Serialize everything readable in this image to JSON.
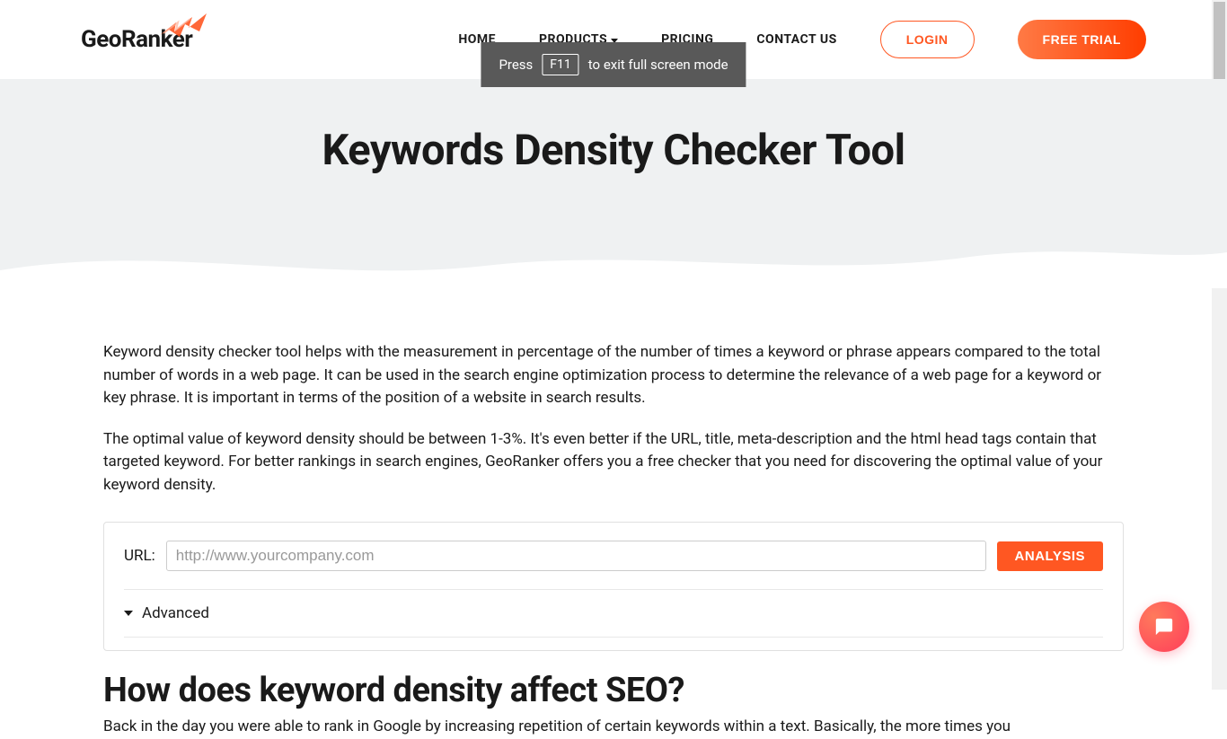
{
  "brand": {
    "name": "GeoRanker"
  },
  "nav": {
    "home": "HOME",
    "products": "PRODUCTS",
    "pricing": "PRICING",
    "contact": "CONTACT US",
    "login": "LOGIN",
    "trial": "FREE TRIAL"
  },
  "hero": {
    "title": "Keywords Density Checker Tool"
  },
  "intro": {
    "p1": "Keyword density checker tool helps with the measurement in percentage of the number of times a keyword or phrase appears compared to the total number of words in a web page. It can be used in the search engine optimization process to determine the relevance of a web page for a keyword or key phrase. It is important in terms of the position of a website in search results.",
    "p2": "The optimal value of keyword density should be between 1-3%. It's even better if the URL, title, meta-description and the html head tags contain that targeted keyword. For better rankings in search engines, GeoRanker offers you a free checker that you need for discovering the optimal value of your keyword density."
  },
  "form": {
    "urlLabel": "URL:",
    "urlPlaceholder": "http://www.yourcompany.com",
    "analysis": "ANALYSIS",
    "advanced": "Advanced"
  },
  "section": {
    "heading": "How does keyword density affect SEO?",
    "body": "Back in the day you were able to rank in Google by increasing repetition of certain keywords within a text. Basically, the more times you"
  },
  "toast": {
    "pre": "Press",
    "key": "F11",
    "post": "to exit full screen mode"
  }
}
